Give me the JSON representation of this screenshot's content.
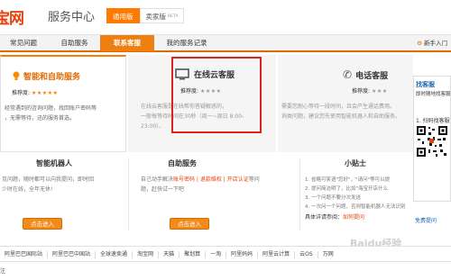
{
  "header": {
    "logo": "宝网",
    "subtitle": "服务中心",
    "version_tabs": [
      {
        "label": "通用版"
      },
      {
        "label": "卖家版",
        "badge": "BETA"
      }
    ]
  },
  "nav": {
    "items": [
      {
        "label": "常见问题"
      },
      {
        "label": "自助服务"
      },
      {
        "label": "联系客服"
      },
      {
        "label": "我的服务记录"
      }
    ],
    "active_index": 2,
    "right": "新手入门"
  },
  "panels": {
    "smart": {
      "title": "智能和自助服务",
      "rating_label": "推荐度:",
      "stars": 5,
      "desc": "经常遇到的咨询问题，找回账户密码等\n，无需等待，迅的服务首选。"
    },
    "online": {
      "title": "在线云客服",
      "rating_label": "推荐度:",
      "stars": 4,
      "desc": "在线云客服是在线帮你答疑解惑的，\n一般每等待时间在30秒（周一~周日 8:00-\n23:00）。"
    },
    "phone": {
      "title": "电话客服",
      "rating_label": "推荐度:",
      "stars": 3,
      "desc": "需要您耐心等待一段时间，且会产生通话费用。\n询类问题，建议您先使用智能机器人和自助服务。"
    }
  },
  "side": {
    "title": "找客服",
    "sub": "即时随地找客服",
    "scan": "1. 扫码找客服",
    "free": "免费提问"
  },
  "middle": {
    "robot": {
      "title": "智能机器人",
      "desc": "见问题，随时都可以向我提问，即时回\n少时在线，全年无休!",
      "button": "点击进入"
    },
    "self": {
      "title": "自助服务",
      "desc_prefix": "自己动手解决",
      "desc_hl": "账号密码 | 退款维权 | 开店认证",
      "desc_suffix": "等问",
      "desc_line2": "题，赶快试一下吧",
      "button": "点击进入"
    },
    "tips": {
      "title": "小贴士",
      "lines": [
        "1. 省略可笑语\"您好\"，\"请问\"等可以提",
        "2. 提问简洁明了，比如\"海宝开店什么",
        "3. 一个问题不要分次发送",
        "4. 一次问一个问题，否则智能机器人无法识别"
      ],
      "more_prefix": "具体详请参阅：",
      "more_link": "如何提问"
    }
  },
  "footer": {
    "links": [
      "阿里巴巴国际站",
      "阿里巴巴中国站",
      "全球速卖通",
      "淘宝网",
      "天猫",
      "聚划算",
      "一淘",
      "阿里妈妈",
      "阿里云计算",
      "云OS",
      "万网"
    ],
    "bottom": "注"
  },
  "watermark": "Baidu经验",
  "colors": {
    "accent": "#ff7a00",
    "brand": "#e8410f",
    "highlight_border": "#d9251c",
    "link_blue": "#1b64b5"
  }
}
